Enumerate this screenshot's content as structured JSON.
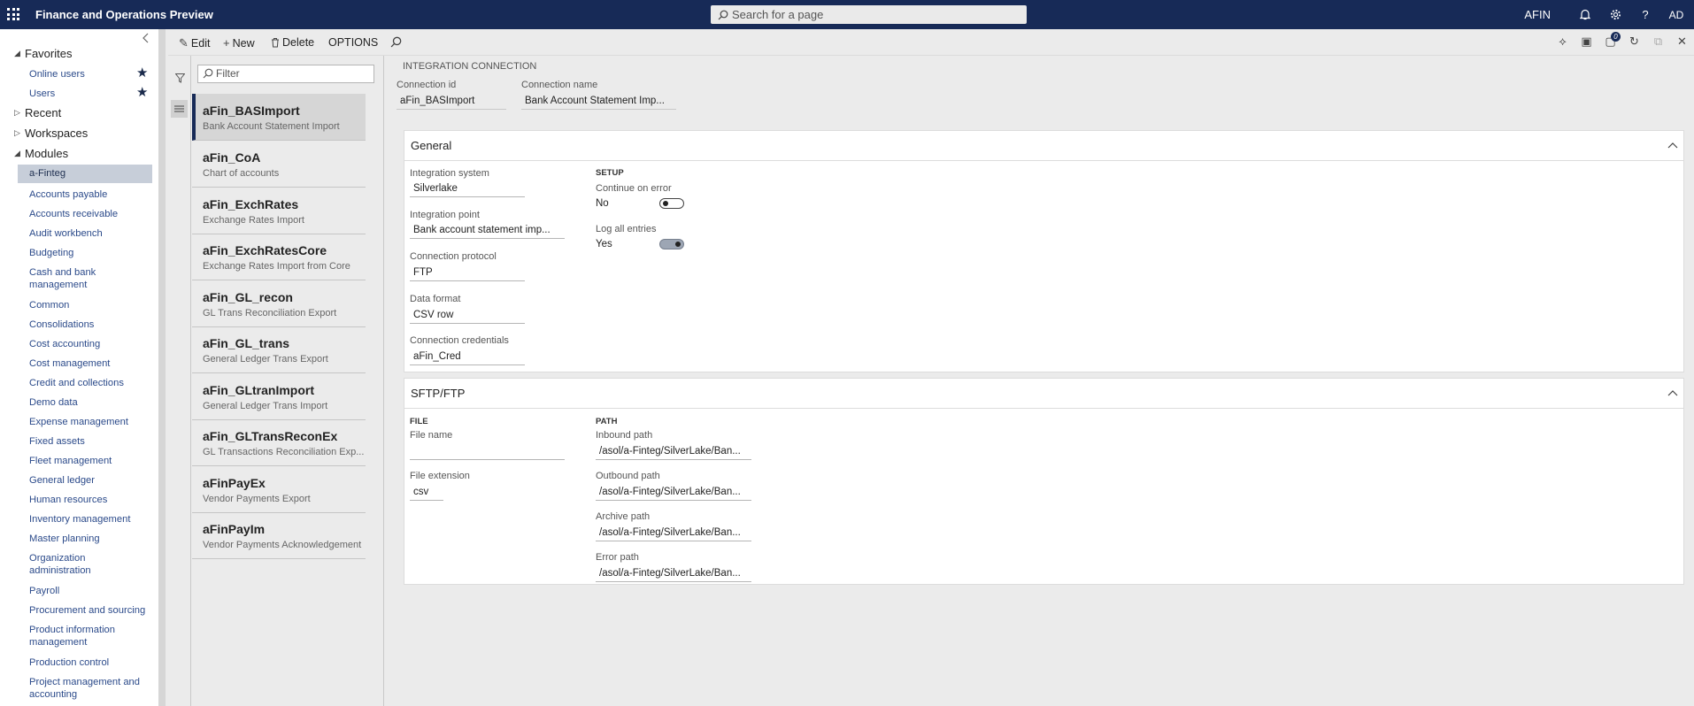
{
  "app": {
    "title": "Finance and Operations Preview",
    "search_placeholder": "Search for a page",
    "company": "AFIN",
    "user_initials": "AD",
    "notification_count": "0"
  },
  "nav": {
    "groups": {
      "favorites": "Favorites",
      "recent": "Recent",
      "workspaces": "Workspaces",
      "modules": "Modules"
    },
    "favorites": [
      "Online users",
      "Users"
    ],
    "modules": [
      "a-Finteg",
      "Accounts payable",
      "Accounts receivable",
      "Audit workbench",
      "Budgeting",
      "Cash and bank management",
      "Common",
      "Consolidations",
      "Cost accounting",
      "Cost management",
      "Credit and collections",
      "Demo data",
      "Expense management",
      "Fixed assets",
      "Fleet management",
      "General ledger",
      "Human resources",
      "Inventory management",
      "Master planning",
      "Organization administration",
      "Payroll",
      "Procurement and sourcing",
      "Product information management",
      "Production control",
      "Project management and accounting"
    ]
  },
  "actions": {
    "edit": "Edit",
    "new": "New",
    "delete": "Delete",
    "options": "OPTIONS"
  },
  "list": {
    "filter_placeholder": "Filter",
    "items": [
      {
        "title": "aFin_BASImport",
        "subtitle": "Bank Account Statement Import"
      },
      {
        "title": "aFin_CoA",
        "subtitle": "Chart of accounts"
      },
      {
        "title": "aFin_ExchRates",
        "subtitle": "Exchange Rates Import"
      },
      {
        "title": "aFin_ExchRatesCore",
        "subtitle": "Exchange Rates Import from Core"
      },
      {
        "title": "aFin_GL_recon",
        "subtitle": "GL Trans Reconciliation Export"
      },
      {
        "title": "aFin_GL_trans",
        "subtitle": "General Ledger Trans Export"
      },
      {
        "title": "aFin_GLtranImport",
        "subtitle": "General Ledger Trans Import"
      },
      {
        "title": "aFin_GLTransReconEx",
        "subtitle": "GL Transactions Reconciliation Exp..."
      },
      {
        "title": "aFinPayEx",
        "subtitle": "Vendor Payments Export"
      },
      {
        "title": "aFinPayIm",
        "subtitle": "Vendor Payments Acknowledgement"
      }
    ]
  },
  "detail": {
    "caption": "INTEGRATION CONNECTION",
    "conn_id_label": "Connection id",
    "conn_id": "aFin_BASImport",
    "conn_name_label": "Connection name",
    "conn_name": "Bank Account Statement Imp...",
    "general": {
      "title": "General",
      "integration_system_label": "Integration system",
      "integration_system": "Silverlake",
      "integration_point_label": "Integration point",
      "integration_point": "Bank account statement imp...",
      "protocol_label": "Connection protocol",
      "protocol": "FTP",
      "data_format_label": "Data format",
      "data_format": "CSV row",
      "credentials_label": "Connection credentials",
      "credentials": "aFin_Cred",
      "setup_label": "SETUP",
      "continue_label": "Continue on error",
      "continue_value": "No",
      "log_label": "Log all entries",
      "log_value": "Yes"
    },
    "sftp": {
      "title": "SFTP/FTP",
      "file_group": "FILE",
      "path_group": "PATH",
      "file_name_label": "File name",
      "file_name": "",
      "file_ext_label": "File extension",
      "file_ext": "csv",
      "inbound_label": "Inbound path",
      "inbound": "/asol/a-Finteg/SilverLake/Ban...",
      "outbound_label": "Outbound path",
      "outbound": "/asol/a-Finteg/SilverLake/Ban...",
      "archive_label": "Archive path",
      "archive": "/asol/a-Finteg/SilverLake/Ban...",
      "error_label": "Error path",
      "error": "/asol/a-Finteg/SilverLake/Ban..."
    }
  }
}
